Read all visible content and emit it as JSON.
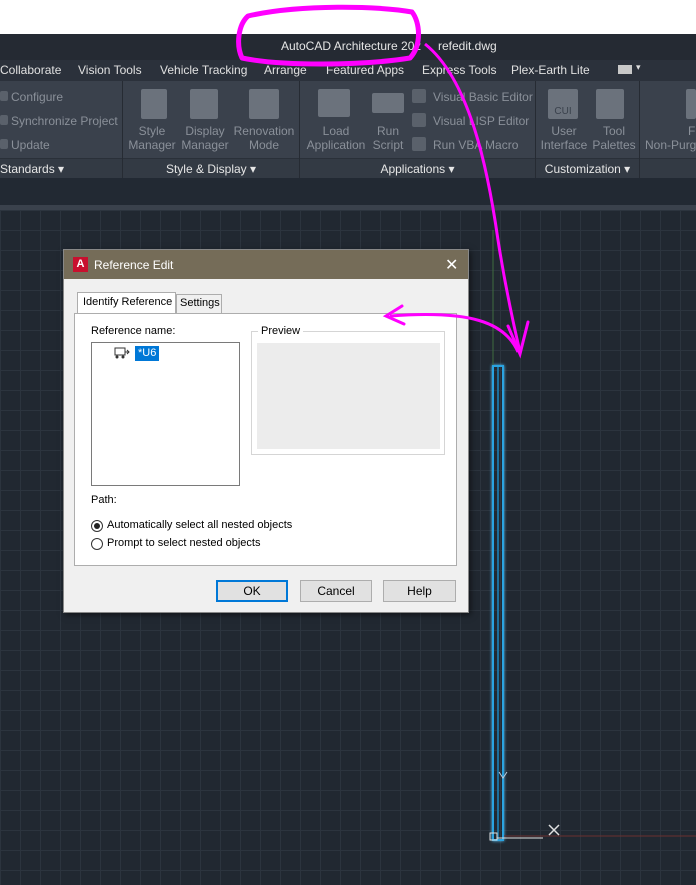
{
  "title_bar": {
    "app": "AutoCAD Architecture 202",
    "file": "refedit.dwg"
  },
  "ribbon_tabs": [
    "Collaborate",
    "Vision Tools",
    "Vehicle Tracking",
    "Arrange",
    "Featured Apps",
    "Express Tools",
    "Plex-Earth Lite"
  ],
  "ribbon": {
    "standards": {
      "items": [
        "Configure",
        "Synchronize Project",
        "Update"
      ],
      "footer": "Standards"
    },
    "style_display": {
      "buttons": [
        [
          "Style",
          "Manager"
        ],
        [
          "Display",
          "Manager"
        ],
        [
          "Renovation",
          "Mode"
        ]
      ],
      "footer": "Style & Display"
    },
    "applications": {
      "buttons": [
        [
          "Load",
          "Application"
        ],
        [
          "Run",
          "Script"
        ]
      ],
      "items": [
        "Visual Basic Editor",
        "Visual LISP Editor",
        "Run VBA Macro"
      ],
      "footer": "Applications"
    },
    "customization": {
      "buttons": [
        [
          "User",
          "Interface"
        ],
        [
          "Tool",
          "Palettes"
        ]
      ],
      "icon_text": "CUI",
      "footer": "Customization"
    },
    "purge": {
      "label": "Non-Purg",
      "sub": "F"
    }
  },
  "dialog": {
    "title": "Reference Edit",
    "tabs": {
      "active": "Identify Reference",
      "other": "Settings"
    },
    "reference_name_label": "Reference name:",
    "tree_item": "*U6",
    "preview_label": "Preview",
    "path_label": "Path:",
    "radio_auto": "Automatically select all nested objects",
    "radio_prompt": "Prompt to select nested objects",
    "buttons": {
      "ok": "OK",
      "cancel": "Cancel",
      "help": "Help"
    }
  },
  "colors": {
    "annotation": "#ff00ff",
    "wall": "#2aa3e0",
    "dialog_title": "#756c58"
  }
}
